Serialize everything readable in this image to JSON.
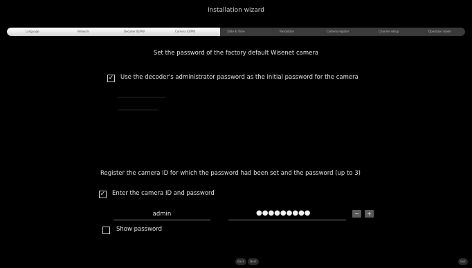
{
  "window_title": "Installation wizard",
  "steps": [
    "Language",
    "Network",
    "Decoder ID/PW",
    "Camera ID/PW",
    "Date & Time",
    "Resolution",
    "Camera register",
    "Channel setup",
    "Operation mode"
  ],
  "heading": "Set the password of the factory default Wisenet camera",
  "use_admin_pw": {
    "checked": true,
    "mark": "✓",
    "label": "Use the decoder's administrator password as the initial password for the camera"
  },
  "register_text": "Register the camera ID for which the password had been set and the password (up to 3)",
  "enter_id_pw": {
    "checked": true,
    "mark": "✓",
    "label": "Enter the camera ID and password"
  },
  "camera_id": "admin",
  "camera_password_masked": "●●●●●●●●●",
  "minus_label": "−",
  "plus_label": "+",
  "show_password": {
    "checked": false,
    "label": "Show password"
  },
  "back_label": "Back",
  "next_label": "Next",
  "exit_label": "Exit"
}
